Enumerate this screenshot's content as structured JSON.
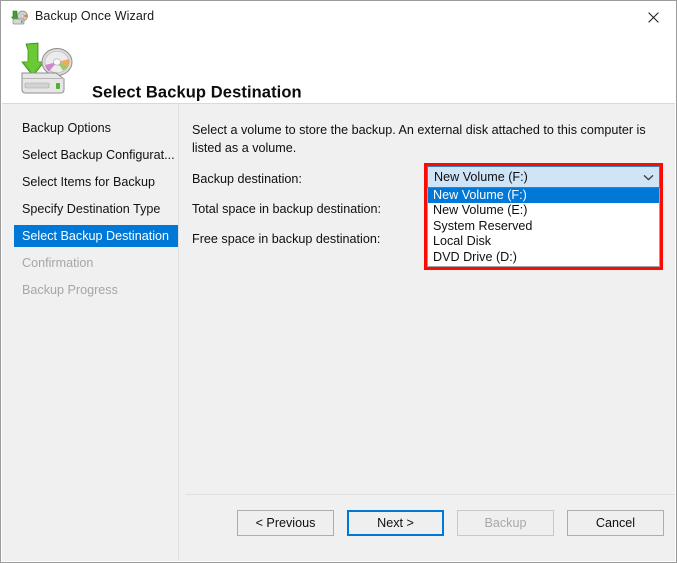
{
  "window": {
    "title": "Backup Once Wizard",
    "title_icon": "backup-disk-icon",
    "close_label": "×"
  },
  "header": {
    "title": "Select Backup Destination",
    "icon": "backup-drive-icon"
  },
  "sidebar": {
    "items": [
      {
        "label": "Backup Options",
        "state": "normal"
      },
      {
        "label": "Select Backup Configurat...",
        "state": "normal"
      },
      {
        "label": "Select Items for Backup",
        "state": "normal"
      },
      {
        "label": "Specify Destination Type",
        "state": "normal"
      },
      {
        "label": "Select Backup Destination",
        "state": "selected"
      },
      {
        "label": "Confirmation",
        "state": "disabled"
      },
      {
        "label": "Backup Progress",
        "state": "disabled"
      }
    ]
  },
  "content": {
    "intro": "Select a volume to store the backup. An external disk attached to this computer is listed as a volume.",
    "labels": {
      "destination": "Backup destination:",
      "total_space": "Total space in backup destination:",
      "free_space": "Free space in backup destination:"
    },
    "combo": {
      "selected": "New Volume (F:)",
      "arrow_icon": "chevron-down-icon",
      "options": [
        {
          "label": "New Volume (F:)",
          "highlighted": true
        },
        {
          "label": "New Volume (E:)",
          "highlighted": false
        },
        {
          "label": "System Reserved",
          "highlighted": false
        },
        {
          "label": "Local Disk",
          "highlighted": false
        },
        {
          "label": "DVD Drive (D:)",
          "highlighted": false
        }
      ]
    }
  },
  "footer": {
    "buttons": [
      {
        "label": "< Previous",
        "state": "normal"
      },
      {
        "label": "Next >",
        "state": "default"
      },
      {
        "label": "Backup",
        "state": "disabled"
      },
      {
        "label": "Cancel",
        "state": "normal"
      }
    ]
  },
  "colors": {
    "accent": "#0078d7",
    "annotation": "#fa0c00",
    "panel": "#f0f0f0",
    "combo_fill": "#cfe4f7"
  }
}
